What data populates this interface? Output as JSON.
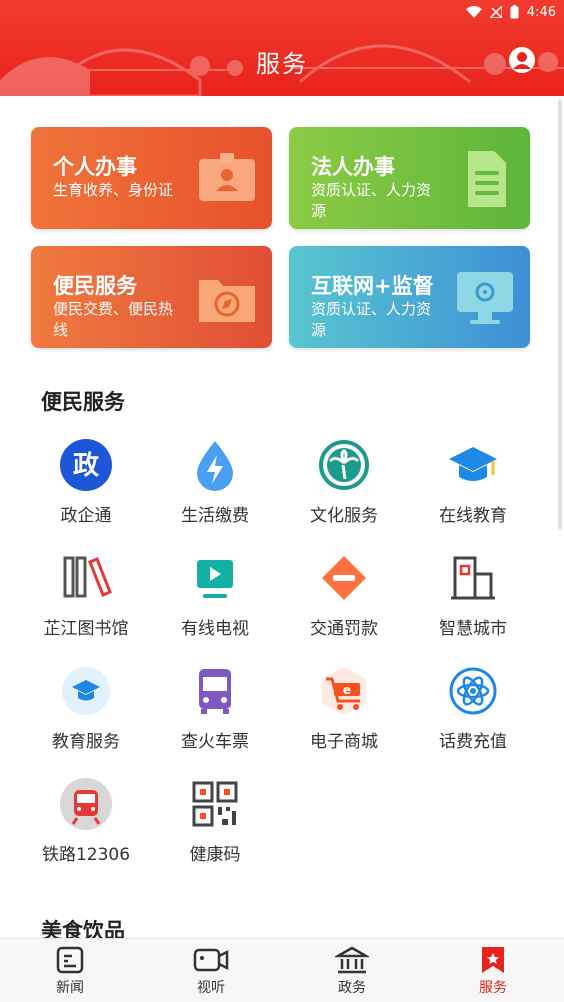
{
  "status_bar": {
    "time": "4:46"
  },
  "header": {
    "title": "服务"
  },
  "cards": [
    {
      "title": "个人办事",
      "subtitle": "生育收养、身份证",
      "icon": "id-card-icon"
    },
    {
      "title": "法人办事",
      "subtitle": "资质认证、人力资源",
      "icon": "document-icon"
    },
    {
      "title": "便民服务",
      "subtitle": "便民交费、便民热线",
      "icon": "compass-folder-icon"
    },
    {
      "title": "互联网+监督",
      "subtitle": "资质认证、人力资源",
      "icon": "monitor-icon"
    }
  ],
  "sections": {
    "convenience": {
      "title": "便民服务",
      "items": [
        {
          "label": "政企通",
          "icon": "zheng-badge-icon"
        },
        {
          "label": "生活缴费",
          "icon": "water-drop-bolt-icon"
        },
        {
          "label": "文化服务",
          "icon": "palm-tree-icon"
        },
        {
          "label": "在线教育",
          "icon": "graduation-cap-icon"
        },
        {
          "label": "芷江图书馆",
          "icon": "books-icon"
        },
        {
          "label": "有线电视",
          "icon": "tv-play-icon"
        },
        {
          "label": "交通罚款",
          "icon": "no-entry-sign-icon"
        },
        {
          "label": "智慧城市",
          "icon": "building-icon"
        },
        {
          "label": "教育服务",
          "icon": "education-cap-icon"
        },
        {
          "label": "查火车票",
          "icon": "bus-icon"
        },
        {
          "label": "电子商城",
          "icon": "shopping-cart-icon"
        },
        {
          "label": "话费充值",
          "icon": "atom-icon"
        },
        {
          "label": "铁路12306",
          "icon": "train-icon"
        },
        {
          "label": "健康码",
          "icon": "qr-code-icon"
        }
      ]
    },
    "food": {
      "title": "美食饮品"
    }
  },
  "bottom_nav": [
    {
      "label": "新闻",
      "icon": "news-icon",
      "active": false
    },
    {
      "label": "视听",
      "icon": "video-camera-icon",
      "active": false
    },
    {
      "label": "政务",
      "icon": "government-icon",
      "active": false
    },
    {
      "label": "服务",
      "icon": "service-bookmark-icon",
      "active": true
    }
  ],
  "colors": {
    "brand_red": "#e8231c"
  }
}
